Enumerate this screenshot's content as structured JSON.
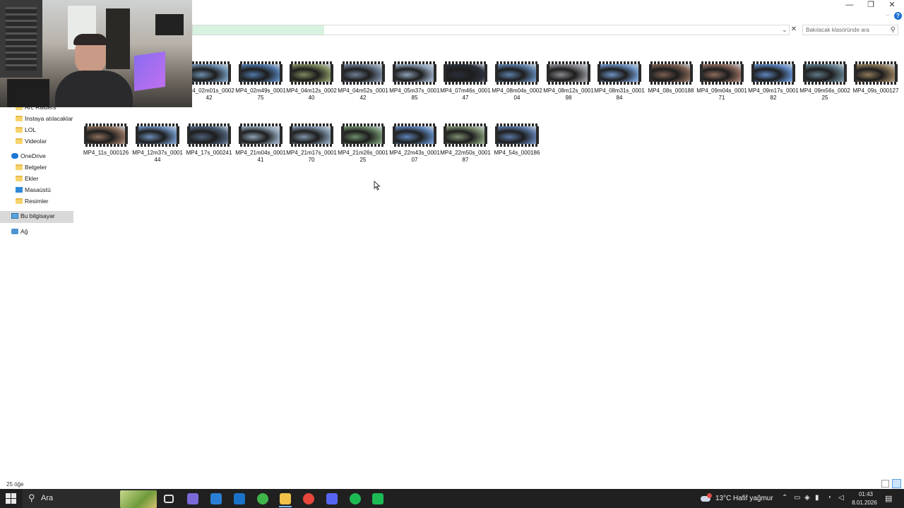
{
  "window": {
    "minimize": "—",
    "maximize": "❐",
    "close": "✕",
    "help": "?"
  },
  "address": {
    "progress": 0.22
  },
  "search": {
    "placeholder": "Bakılacak klasöründe ara"
  },
  "sidebar": {
    "items": [
      {
        "label": "Arc Raiders",
        "icon": "folder-icon",
        "indent": 2
      },
      {
        "label": "İnstaya atılacaklar",
        "icon": "folder-icon",
        "indent": 2
      },
      {
        "label": "LOL",
        "icon": "folder-icon",
        "indent": 2
      },
      {
        "label": "Videolar",
        "icon": "folder-icon",
        "indent": 2
      },
      {
        "label": "OneDrive",
        "icon": "cloud-icon",
        "indent": 1
      },
      {
        "label": "Belgeler",
        "icon": "folder-icon",
        "indent": 2
      },
      {
        "label": "Ekler",
        "icon": "folder-icon",
        "indent": 2
      },
      {
        "label": "Masaüstü",
        "icon": "desktop-icon",
        "indent": 2
      },
      {
        "label": "Resimler",
        "icon": "folder-icon",
        "indent": 2
      },
      {
        "label": "Bu bilgisayar",
        "icon": "pc-icon",
        "indent": 1,
        "selected": true
      },
      {
        "label": "Ağ",
        "icon": "network-icon",
        "indent": 1
      }
    ]
  },
  "files": [
    {
      "name": "MP4_02m01s_000242",
      "color": "#6d8fb0"
    },
    {
      "name": "MP4_02m49s_000175",
      "color": "#4f78a8"
    },
    {
      "name": "MP4_04m12s_000240",
      "color": "#7d8a5d"
    },
    {
      "name": "MP4_04m52s_000142",
      "color": "#6f7f95"
    },
    {
      "name": "MP4_05m37s_000185",
      "color": "#8fa1b8"
    },
    {
      "name": "MP4_07m46s_000147",
      "color": "#2a2f3a"
    },
    {
      "name": "MP4_08m04s_000204",
      "color": "#5c7fa8"
    },
    {
      "name": "MP4_08m12s_000198",
      "color": "#8a8a90"
    },
    {
      "name": "MP4_08m31s_000184",
      "color": "#6d93c4"
    },
    {
      "name": "MP4_08s_000188",
      "color": "#7a5e50"
    },
    {
      "name": "MP4_09m04s_000171",
      "color": "#8c6a5c"
    },
    {
      "name": "MP4_09m17s_000182",
      "color": "#5d86c0"
    },
    {
      "name": "MP4_09m56s_000225",
      "color": "#5f7a88"
    },
    {
      "name": "MP4_09s_000127",
      "color": "#8e7a5a"
    },
    {
      "name": "MP4_11s_000126",
      "color": "#8a6d5a"
    },
    {
      "name": "MP4_12m37s_000144",
      "color": "#6c8db9"
    },
    {
      "name": "MP4_17s_000241",
      "color": "#4d6078"
    },
    {
      "name": "MP4_21m04s_000141",
      "color": "#8fa3b5"
    },
    {
      "name": "MP4_21m17s_000170",
      "color": "#7e93a8"
    },
    {
      "name": "MP4_21m26s_000125",
      "color": "#6d8c6a"
    },
    {
      "name": "MP4_22m43s_000107",
      "color": "#5e84b8"
    },
    {
      "name": "MP4_22m50s_000187",
      "color": "#7e9070"
    },
    {
      "name": "MP4_54s_000186",
      "color": "#5a77a4"
    }
  ],
  "status": {
    "item_count": "25 öğe"
  },
  "taskbar": {
    "search_text": "Ara",
    "apps": [
      {
        "name": "task-view-icon",
        "color": "#202020"
      },
      {
        "name": "copilot-icon",
        "color": "#7a6ad8"
      },
      {
        "name": "store-icon",
        "color": "#2a7fd4"
      },
      {
        "name": "outlook-icon",
        "color": "#1a73c8"
      },
      {
        "name": "xbox-icon",
        "color": "#3fb44a"
      },
      {
        "name": "file-explorer-icon",
        "color": "#f0c24a"
      },
      {
        "name": "chrome-icon",
        "color": "#e8453c"
      },
      {
        "name": "discord-icon",
        "color": "#5865f2"
      },
      {
        "name": "spotify-icon",
        "color": "#1db954"
      },
      {
        "name": "terminal-icon",
        "color": "#1db954"
      }
    ],
    "weather_temp": "13°C",
    "weather_desc": "Hafif yağmur",
    "clock_time": "01:43",
    "clock_date": "8.01.2026",
    "tray_icons": [
      "chevron-up-icon",
      "network-icon",
      "shield-icon",
      "onedrive-icon",
      "microphone-icon",
      "wifi-icon",
      "volume-icon"
    ]
  }
}
